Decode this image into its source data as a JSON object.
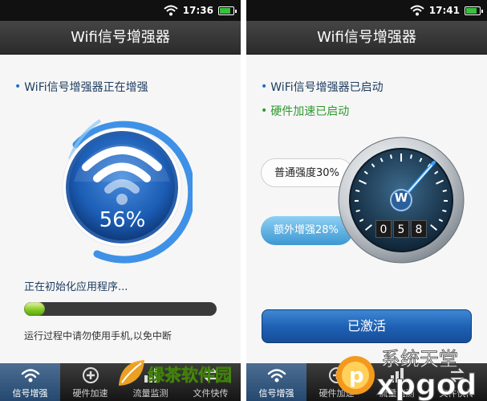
{
  "left_screen": {
    "status": {
      "time": "17:36"
    },
    "title": "Wifi信号增强器",
    "status_line": "WiFi信号增强器正在增强",
    "gauge": {
      "percent_text": "56%",
      "progress": 0.56
    },
    "init_text": "正在初始化应用程序...",
    "init_progress": 0.11,
    "hint": "运行过程中请勿使用手机,以免中断",
    "tabs": [
      {
        "label": "信号增强",
        "icon": "wifi-icon",
        "active": true
      },
      {
        "label": "硬件加速",
        "icon": "plus-circle-icon",
        "active": false
      },
      {
        "label": "流量监测",
        "icon": "chart-icon",
        "active": false
      },
      {
        "label": "文件快传",
        "icon": "transfer-icon",
        "active": false
      }
    ]
  },
  "right_screen": {
    "status": {
      "time": "17:41"
    },
    "title": "Wifi信号增强器",
    "status_line_1": "WiFi信号增强器已启动",
    "status_line_2": "硬件加速已启动",
    "normal_strength": "普通强度30%",
    "extra_boost": "额外增强28%",
    "speedometer": {
      "digits": [
        "0",
        "5",
        "8"
      ],
      "letter": "W"
    },
    "activate_button": "已激活",
    "tabs": [
      {
        "label": "信号增强",
        "icon": "wifi-icon",
        "active": true
      },
      {
        "label": "硬件加速",
        "icon": "plus-circle-icon",
        "active": false
      },
      {
        "label": "流量监测",
        "icon": "chart-icon",
        "active": false
      },
      {
        "label": "文件快传",
        "icon": "transfer-icon",
        "active": false
      }
    ]
  },
  "watermarks": {
    "left": "绿茶软件园",
    "right_cn": "系统天堂",
    "right_en": "xpgod"
  },
  "colors": {
    "accent": "#1d5fb3",
    "title_bar": "#333333",
    "progress_green": "#7ec51f",
    "status_green": "#2d9a2d"
  }
}
